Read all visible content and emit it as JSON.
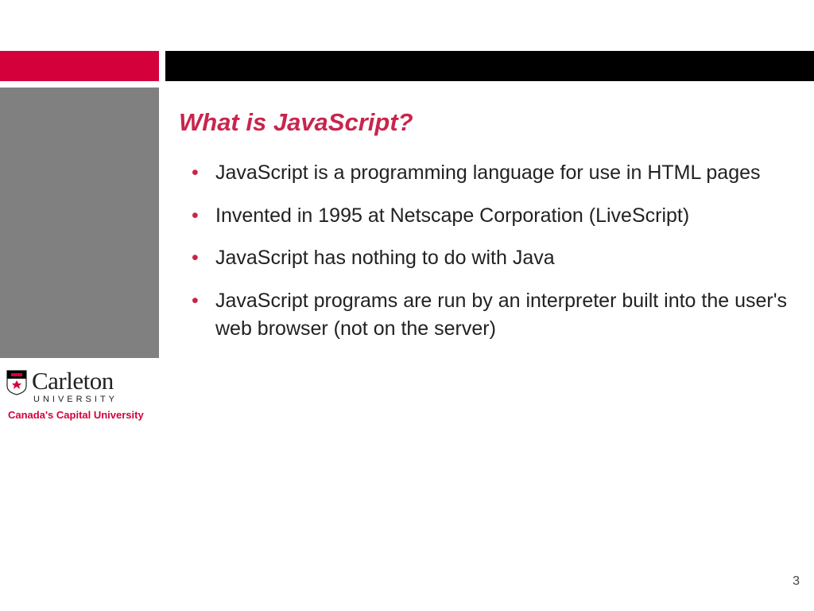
{
  "slide": {
    "title": "What is JavaScript?",
    "bullets": [
      "JavaScript is a programming language for use in HTML pages",
      "Invented in 1995 at Netscape Corporation (LiveScript)",
      "JavaScript has nothing to do with Java",
      "JavaScript programs are run by an interpreter built into the user's web browser (not on the server)"
    ],
    "page_number": "3"
  },
  "branding": {
    "institution": "Carleton",
    "subtext": "UNIVERSITY",
    "tagline": "Canada's Capital University"
  },
  "colors": {
    "accent_red": "#d4003c",
    "title_red": "#c8254d",
    "gray": "#808080",
    "black": "#000000"
  }
}
